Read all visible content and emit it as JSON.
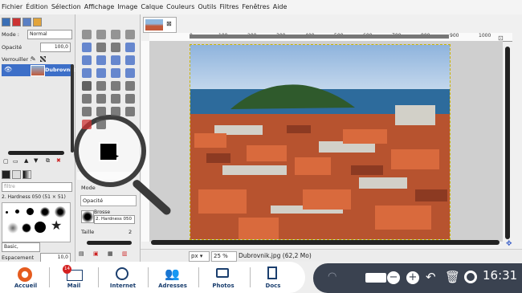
{
  "menubar": {
    "items": [
      "Fichier",
      "Édition",
      "Sélection",
      "Affichage",
      "Image",
      "Calque",
      "Couleurs",
      "Outils",
      "Filtres",
      "Fenêtres",
      "Aide"
    ]
  },
  "layers": {
    "mode_label": "Mode :",
    "mode_value": "Normal",
    "opacity_label": "Opacité",
    "opacity_value": "100,0",
    "lock_label": "Verrouiller :",
    "layer_name": "Dubrovnik.jpg"
  },
  "brushes": {
    "filter_placeholder": "filtre",
    "brush_name": "2. Hardness 050 (51 × 51)",
    "preset": "Basic,",
    "spacing_label": "Espacement",
    "spacing_value": "10,0"
  },
  "tool_options": {
    "mode_label": "Mode",
    "opacity_label": "Opacité",
    "brush_label": "Brosse",
    "brush_value": "2. Hardness 050",
    "size_label": "Taille",
    "size_value": "2"
  },
  "canvas": {
    "ruler_ticks": [
      "0",
      "100",
      "200",
      "300",
      "400",
      "500",
      "600",
      "700",
      "800",
      "900",
      "1000"
    ]
  },
  "statusbar": {
    "unit": "px",
    "zoom": "25 %",
    "file_info": "Dubrovnik.jpg (62,2 Mo)"
  },
  "taskbar": {
    "apps": [
      {
        "label": "Accueil",
        "icon": "home-icon"
      },
      {
        "label": "Mail",
        "icon": "mail-icon",
        "badge": "14"
      },
      {
        "label": "Internet",
        "icon": "globe-icon"
      },
      {
        "label": "Adresses",
        "icon": "contacts-icon"
      },
      {
        "label": "Photos",
        "icon": "camera-icon"
      },
      {
        "label": "Docs",
        "icon": "documents-icon"
      }
    ],
    "clock": "16:31"
  }
}
